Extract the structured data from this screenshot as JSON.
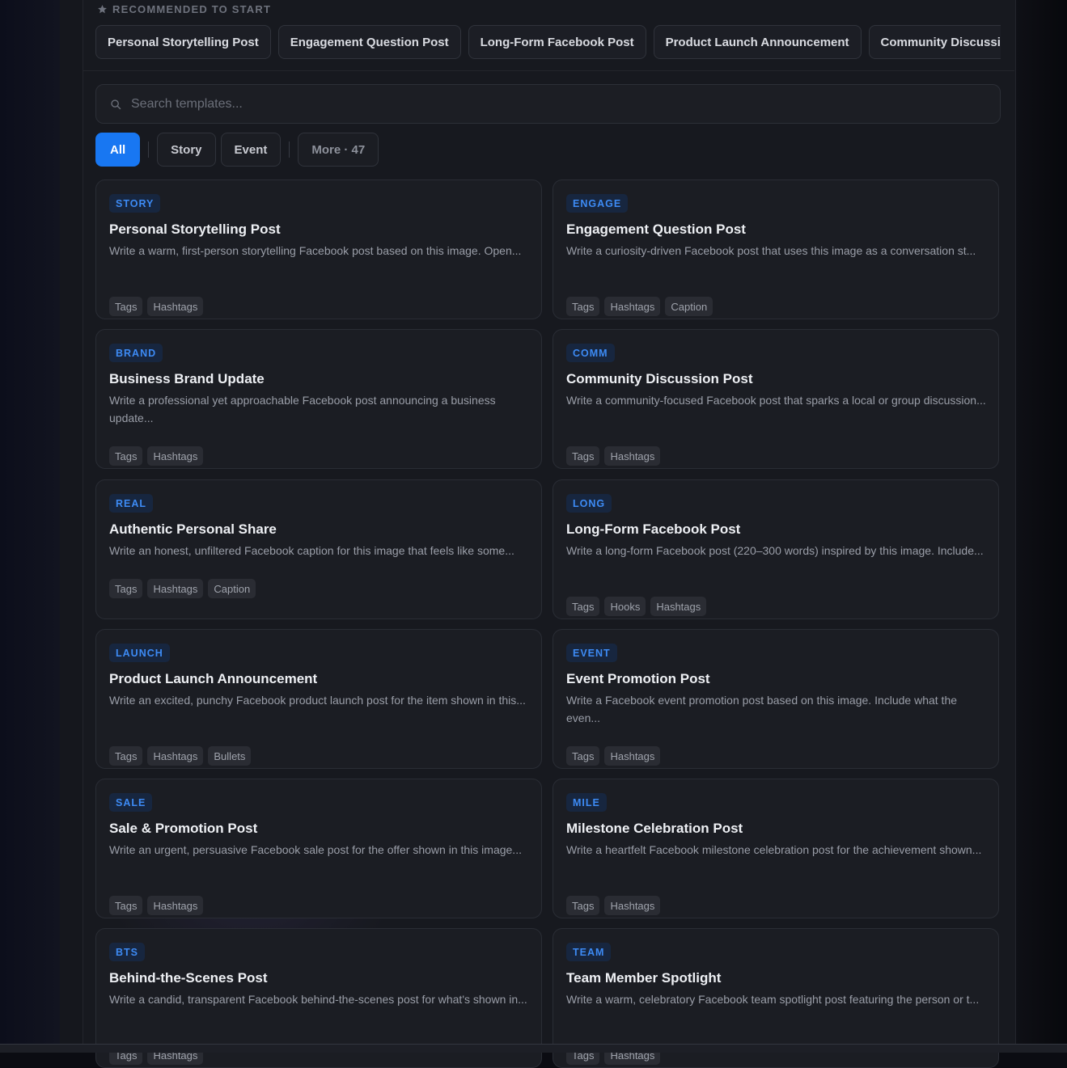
{
  "recommended": {
    "heading": "RECOMMENDED TO START",
    "chips": [
      "Personal Storytelling Post",
      "Engagement Question Post",
      "Long-Form Facebook Post",
      "Product Launch Announcement",
      "Community Discussion Post"
    ]
  },
  "search": {
    "placeholder": "Search templates..."
  },
  "filters": {
    "all": "All",
    "story": "Story",
    "event": "Event",
    "more": "More · 47"
  },
  "colors": {
    "accent": "#1877f2",
    "badge_text": "#3d8bf5",
    "badge_bg": "#17263f"
  },
  "cards": [
    {
      "badge": "STORY",
      "title": "Personal Storytelling Post",
      "desc": "Write a warm, first-person storytelling Facebook post based on this image. Open...",
      "tags": [
        "Tags",
        "Hashtags"
      ]
    },
    {
      "badge": "ENGAGE",
      "title": "Engagement Question Post",
      "desc": "Write a curiosity-driven Facebook post that uses this image as a conversation st...",
      "tags": [
        "Tags",
        "Hashtags",
        "Caption"
      ]
    },
    {
      "badge": "BRAND",
      "title": "Business Brand Update",
      "desc": "Write a professional yet approachable Facebook post announcing a business update...",
      "tags": [
        "Tags",
        "Hashtags"
      ]
    },
    {
      "badge": "COMM",
      "title": "Community Discussion Post",
      "desc": "Write a community-focused Facebook post that sparks a local or group discussion...",
      "tags": [
        "Tags",
        "Hashtags"
      ]
    },
    {
      "badge": "REAL",
      "title": "Authentic Personal Share",
      "desc": "Write an honest, unfiltered Facebook caption for this image that feels like some...",
      "tags": [
        "Tags",
        "Hashtags",
        "Caption"
      ]
    },
    {
      "badge": "LONG",
      "title": "Long-Form Facebook Post",
      "desc": "Write a long-form Facebook post (220–300 words) inspired by this image. Include...",
      "tags": [
        "Tags",
        "Hooks",
        "Hashtags"
      ]
    },
    {
      "badge": "LAUNCH",
      "title": "Product Launch Announcement",
      "desc": "Write an excited, punchy Facebook product launch post for the item shown in this...",
      "tags": [
        "Tags",
        "Hashtags",
        "Bullets"
      ]
    },
    {
      "badge": "EVENT",
      "title": "Event Promotion Post",
      "desc": "Write a Facebook event promotion post based on this image. Include what the even...",
      "tags": [
        "Tags",
        "Hashtags"
      ]
    },
    {
      "badge": "SALE",
      "title": "Sale & Promotion Post",
      "desc": "Write an urgent, persuasive Facebook sale post for the offer shown in this image...",
      "tags": [
        "Tags",
        "Hashtags"
      ]
    },
    {
      "badge": "MILE",
      "title": "Milestone Celebration Post",
      "desc": "Write a heartfelt Facebook milestone celebration post for the achievement shown...",
      "tags": [
        "Tags",
        "Hashtags"
      ]
    },
    {
      "badge": "BTS",
      "title": "Behind-the-Scenes Post",
      "desc": "Write a candid, transparent Facebook behind-the-scenes post for what's shown in...",
      "tags": [
        "Tags",
        "Hashtags"
      ]
    },
    {
      "badge": "TEAM",
      "title": "Team Member Spotlight",
      "desc": "Write a warm, celebratory Facebook team spotlight post featuring the person or t...",
      "tags": [
        "Tags",
        "Hashtags"
      ]
    }
  ]
}
